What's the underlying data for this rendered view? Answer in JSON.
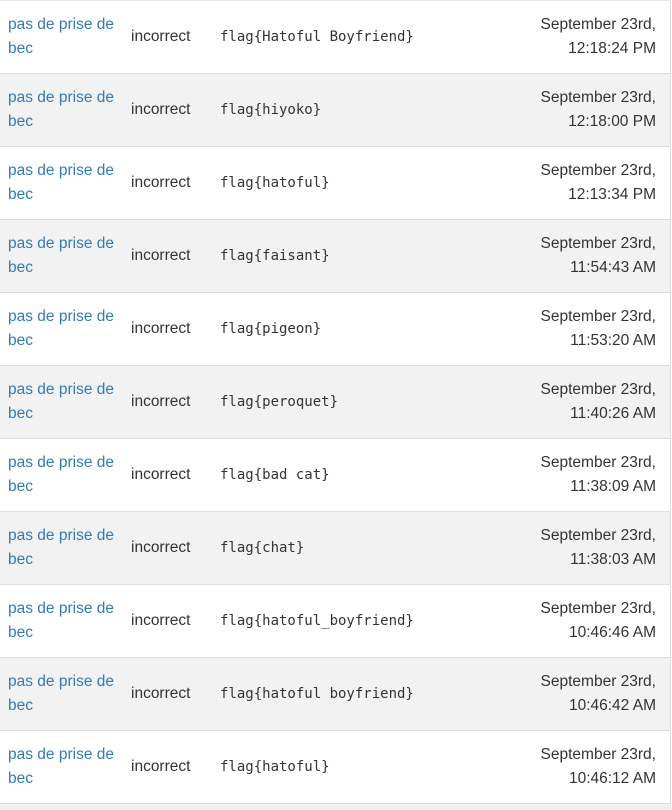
{
  "submissions": [
    {
      "team": "pas de prise de bec",
      "status": "incorrect",
      "flag": "flag{Hatoful Boyfriend}",
      "date": "September 23rd,",
      "time": "12:18:24 PM"
    },
    {
      "team": "pas de prise de bec",
      "status": "incorrect",
      "flag": "flag{hiyoko}",
      "date": "September 23rd,",
      "time": "12:18:00 PM"
    },
    {
      "team": "pas de prise de bec",
      "status": "incorrect",
      "flag": "flag{hatoful}",
      "date": "September 23rd,",
      "time": "12:13:34 PM"
    },
    {
      "team": "pas de prise de bec",
      "status": "incorrect",
      "flag": "flag{faisant}",
      "date": "September 23rd,",
      "time": "11:54:43 AM"
    },
    {
      "team": "pas de prise de bec",
      "status": "incorrect",
      "flag": "flag{pigeon}",
      "date": "September 23rd,",
      "time": "11:53:20 AM"
    },
    {
      "team": "pas de prise de bec",
      "status": "incorrect",
      "flag": "flag{peroquet}",
      "date": "September 23rd,",
      "time": "11:40:26 AM"
    },
    {
      "team": "pas de prise de bec",
      "status": "incorrect",
      "flag": "flag{bad cat}",
      "date": "September 23rd,",
      "time": "11:38:09 AM"
    },
    {
      "team": "pas de prise de bec",
      "status": "incorrect",
      "flag": "flag{chat}",
      "date": "September 23rd,",
      "time": "11:38:03 AM"
    },
    {
      "team": "pas de prise de bec",
      "status": "incorrect",
      "flag": "flag{hatoful_boyfriend}",
      "date": "September 23rd,",
      "time": "10:46:46 AM"
    },
    {
      "team": "pas de prise de bec",
      "status": "incorrect",
      "flag": "flag{hatoful boyfriend}",
      "date": "September 23rd,",
      "time": "10:46:42 AM"
    },
    {
      "team": "pas de prise de bec",
      "status": "incorrect",
      "flag": "flag{hatoful}",
      "date": "September 23rd,",
      "time": "10:46:12 AM"
    }
  ],
  "colors": {
    "link": "#337ab7",
    "row_alt": "#f2f2f2",
    "text": "#333333"
  }
}
